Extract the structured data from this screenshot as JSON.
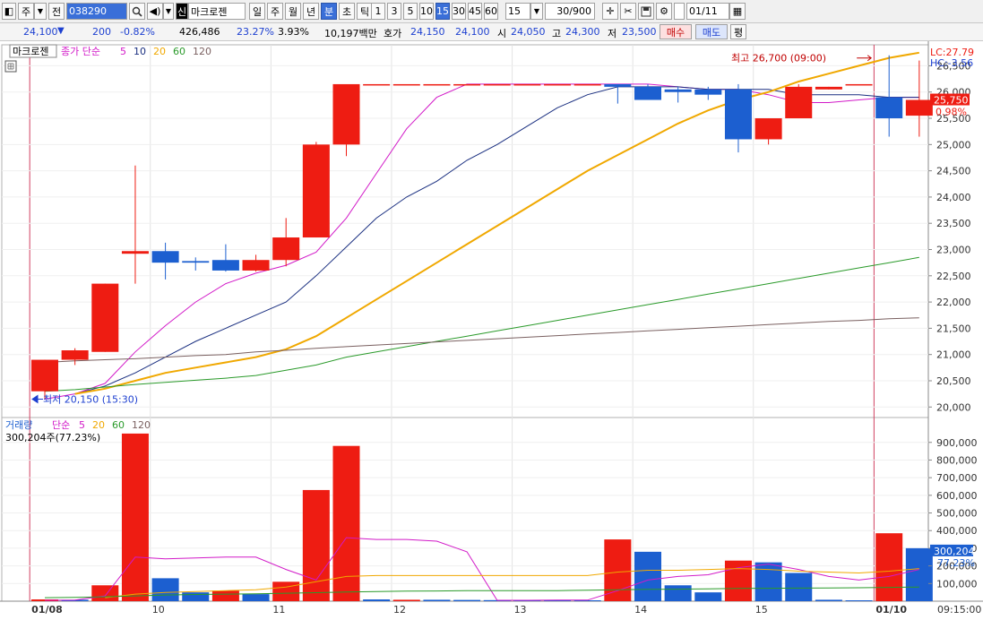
{
  "toolbar": {
    "market": "주",
    "prev_label": "전",
    "code": "038290",
    "name_badge": "신",
    "name": "마크로젠",
    "periods": [
      "일",
      "주",
      "월",
      "년",
      "분",
      "초",
      "틱"
    ],
    "active_period": "분",
    "intervals": [
      "1",
      "3",
      "5",
      "10",
      "15",
      "30",
      "45",
      "60"
    ],
    "active_interval": "15",
    "interval_value": "15",
    "count": "30/900",
    "date": "01/11"
  },
  "quote": {
    "price": "24,100",
    "change": "200",
    "change_rate": "-0.82%",
    "volume": "426,486",
    "turnover_rate": "23.27%",
    "ratio": "3.93%",
    "amount": "10,197백만",
    "ask_label": "호가",
    "ask1": "24,150",
    "ask2": "24,100",
    "open_label": "시",
    "open": "24,050",
    "high_label": "고",
    "high": "24,300",
    "low_label": "저",
    "low": "23,500",
    "buy_label": "매수",
    "sell_label": "매도",
    "flat_label": "평"
  },
  "price_panel": {
    "title": "마크로젠",
    "ma_label": "종가 단순",
    "ma_periods": [
      "5",
      "10",
      "20",
      "60",
      "120"
    ],
    "lc_label": "LC:27.79",
    "hc_label": "HC:-3.56",
    "current_price": "25,750",
    "current_rate": "0.98%",
    "high_annotation": "최고 26,700 (09:00)",
    "low_annotation": "최저 20,150 (15:30)"
  },
  "volume_panel": {
    "title": "거래량",
    "ma_label": "단순",
    "ma_periods": [
      "5",
      "20",
      "60",
      "120"
    ],
    "current_label": "300,204주(77.23%)",
    "current_value": "300,204",
    "current_rate": "77.23%"
  },
  "x_labels": [
    {
      "bar": 0,
      "text": "01/08"
    },
    {
      "bar": 4,
      "text": "10"
    },
    {
      "bar": 8,
      "text": "11"
    },
    {
      "bar": 12,
      "text": "12"
    },
    {
      "bar": 16,
      "text": "13"
    },
    {
      "bar": 20,
      "text": "14"
    },
    {
      "bar": 24,
      "text": "15"
    },
    {
      "bar": 28,
      "text": "01/10"
    }
  ],
  "time_label": "09:15:00",
  "colors": {
    "up": "#ee1c12",
    "down": "#1c5fd0",
    "ma5": "#d21ac8",
    "ma10": "#1a2f80",
    "ma20": "#f0a800",
    "ma60": "#2a9a2a",
    "ma120": "#7a6060"
  },
  "chart_data": [
    {
      "type": "candlestick",
      "ylim": [
        19800,
        26900
      ],
      "y_ticks": [
        20000,
        20500,
        21000,
        21500,
        22000,
        22500,
        23000,
        23500,
        24000,
        24500,
        25000,
        25500,
        26000,
        26500
      ],
      "y_tick_labels": [
        "20,000",
        "20,500",
        "21,000",
        "21,500",
        "22,000",
        "22,500",
        "23,000",
        "23,500",
        "24,000",
        "24,500",
        "25,000",
        "25,500",
        "26,000",
        "26,500"
      ],
      "candles": [
        {
          "o": 20300,
          "h": 20900,
          "l": 20150,
          "c": 20900
        },
        {
          "o": 20900,
          "h": 21120,
          "l": 20800,
          "c": 21080
        },
        {
          "o": 21050,
          "h": 22350,
          "l": 21050,
          "c": 22350
        },
        {
          "o": 22920,
          "h": 24600,
          "l": 22350,
          "c": 22970
        },
        {
          "o": 22970,
          "h": 23130,
          "l": 22430,
          "c": 22750
        },
        {
          "o": 22780,
          "h": 22850,
          "l": 22600,
          "c": 22750
        },
        {
          "o": 22800,
          "h": 23100,
          "l": 22580,
          "c": 22600
        },
        {
          "o": 22600,
          "h": 22900,
          "l": 22580,
          "c": 22800
        },
        {
          "o": 22800,
          "h": 23600,
          "l": 22680,
          "c": 23230
        },
        {
          "o": 23230,
          "h": 25050,
          "l": 23230,
          "c": 25000
        },
        {
          "o": 25000,
          "h": 26150,
          "l": 24780,
          "c": 26150
        },
        {
          "o": 26150,
          "h": 26150,
          "l": 26150,
          "c": 26150
        },
        {
          "o": 26150,
          "h": 26150,
          "l": 26150,
          "c": 26150
        },
        {
          "o": 26150,
          "h": 26150,
          "l": 26150,
          "c": 26150
        },
        {
          "o": 26150,
          "h": 26150,
          "l": 26150,
          "c": 26150
        },
        {
          "o": 26150,
          "h": 26150,
          "l": 26150,
          "c": 26150
        },
        {
          "o": 26150,
          "h": 26150,
          "l": 26150,
          "c": 26150
        },
        {
          "o": 26150,
          "h": 26150,
          "l": 26150,
          "c": 26150
        },
        {
          "o": 26150,
          "h": 26150,
          "l": 26150,
          "c": 26150
        },
        {
          "o": 26150,
          "h": 26150,
          "l": 25780,
          "c": 26100
        },
        {
          "o": 26100,
          "h": 26150,
          "l": 25900,
          "c": 25850
        },
        {
          "o": 26050,
          "h": 26100,
          "l": 25800,
          "c": 26000
        },
        {
          "o": 26050,
          "h": 26100,
          "l": 25850,
          "c": 25950
        },
        {
          "o": 26050,
          "h": 26150,
          "l": 24850,
          "c": 25100
        },
        {
          "o": 25100,
          "h": 25500,
          "l": 25000,
          "c": 25500
        },
        {
          "o": 25500,
          "h": 26150,
          "l": 25500,
          "c": 26100
        },
        {
          "o": 26050,
          "h": 26100,
          "l": 26050,
          "c": 26100
        },
        {
          "o": 26150,
          "h": 26150,
          "l": 26150,
          "c": 26150
        },
        {
          "o": 25900,
          "h": 26700,
          "l": 25150,
          "c": 25500
        },
        {
          "o": 25550,
          "h": 26600,
          "l": 25150,
          "c": 25850
        }
      ],
      "ma": [
        {
          "name": "5",
          "color": "#d21ac8",
          "values": [
            20150,
            20250,
            20450,
            21050,
            21550,
            22000,
            22350,
            22550,
            22700,
            22950,
            23600,
            24450,
            25300,
            25900,
            26150,
            26150,
            26150,
            26150,
            26150,
            26150,
            26150,
            26100,
            26050,
            26050,
            25950,
            25800,
            25800,
            25850,
            25900,
            25900
          ]
        },
        {
          "name": "10",
          "color": "#1a2f80",
          "values": [
            null,
            20250,
            20400,
            20650,
            20950,
            21250,
            21500,
            21750,
            22000,
            22500,
            23050,
            23600,
            24000,
            24300,
            24700,
            25000,
            25350,
            25700,
            25950,
            26100,
            26100,
            26100,
            26050,
            26050,
            26050,
            25950,
            25950,
            25950,
            25900,
            25900
          ]
        },
        {
          "name": "20",
          "color": "#f0a800",
          "values": [
            null,
            20250,
            20350,
            20500,
            20650,
            20750,
            20850,
            20950,
            21100,
            21350,
            21700,
            22050,
            22400,
            22750,
            23100,
            23450,
            23800,
            24150,
            24500,
            24800,
            25100,
            25400,
            25650,
            25850,
            26000,
            26200,
            26350,
            26500,
            26650,
            26750
          ]
        },
        {
          "name": "60",
          "color": "#2a9a2a",
          "values": [
            20300,
            20330,
            20380,
            20430,
            20470,
            20510,
            20550,
            20600,
            20700,
            20800,
            20950,
            21050,
            21150,
            21250,
            21350,
            21450,
            21550,
            21650,
            21750,
            21850,
            21950,
            22050,
            22150,
            22250,
            22350,
            22450,
            22550,
            22650,
            22750,
            22850
          ]
        },
        {
          "name": "120",
          "color": "#7a6060",
          "values": [
            20850,
            20880,
            20900,
            20920,
            20950,
            20980,
            21000,
            21050,
            21080,
            21120,
            21150,
            21180,
            21210,
            21240,
            21270,
            21300,
            21330,
            21360,
            21390,
            21420,
            21450,
            21480,
            21510,
            21540,
            21570,
            21600,
            21630,
            21650,
            21680,
            21700
          ]
        }
      ]
    },
    {
      "type": "bar",
      "ylim": [
        0,
        980000
      ],
      "y_ticks": [
        100000,
        200000,
        300000,
        400000,
        500000,
        600000,
        700000,
        800000,
        900000
      ],
      "y_tick_labels": [
        "100,000",
        "200,000",
        "300,000",
        "400,000",
        "500,000",
        "600,000",
        "700,000",
        "800,000",
        "900,000"
      ],
      "values": [
        10000,
        8000,
        90000,
        950000,
        130000,
        50000,
        60000,
        40000,
        110000,
        630000,
        880000,
        10000,
        8000,
        8000,
        7000,
        6000,
        6000,
        6000,
        5000,
        350000,
        280000,
        90000,
        50000,
        230000,
        220000,
        160000,
        8000,
        5000,
        385000,
        300204
      ],
      "up": [
        true,
        false,
        true,
        true,
        false,
        false,
        true,
        false,
        true,
        true,
        true,
        false,
        true,
        false,
        false,
        false,
        false,
        false,
        false,
        true,
        false,
        false,
        false,
        true,
        false,
        false,
        false,
        false,
        true,
        false
      ],
      "ma": [
        {
          "name": "5",
          "color": "#d21ac8",
          "values": [
            5000,
            6000,
            30000,
            250000,
            240000,
            245000,
            250000,
            250000,
            180000,
            120000,
            360000,
            350000,
            350000,
            340000,
            280000,
            5000,
            5000,
            6000,
            6000,
            60000,
            120000,
            140000,
            150000,
            190000,
            210000,
            180000,
            140000,
            120000,
            140000,
            180000
          ]
        },
        {
          "name": "20",
          "color": "#f0a800",
          "values": [
            null,
            null,
            20000,
            40000,
            50000,
            55000,
            60000,
            65000,
            80000,
            110000,
            140000,
            145000,
            145000,
            145000,
            145000,
            145000,
            145000,
            145000,
            145000,
            165000,
            175000,
            175000,
            180000,
            185000,
            180000,
            170000,
            165000,
            160000,
            170000,
            185000
          ]
        },
        {
          "name": "60",
          "color": "#2a9a2a",
          "values": [
            20000,
            22000,
            25000,
            30000,
            35000,
            38000,
            40000,
            42000,
            45000,
            48000,
            52000,
            55000,
            57000,
            58000,
            60000,
            60000,
            60000,
            60000,
            62000,
            65000,
            67000,
            68000,
            70000,
            72000,
            73000,
            74000,
            75000,
            76000,
            78000,
            80000
          ]
        }
      ]
    }
  ]
}
